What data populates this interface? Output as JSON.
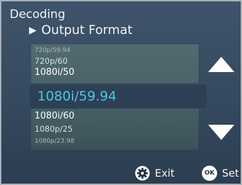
{
  "screen": {
    "title": "Decoding",
    "subtitle": "Output Format",
    "subtitle_icon": "right-triangle-icon"
  },
  "options": {
    "above": [
      "720p/59.94",
      "720p/60",
      "1080i/50"
    ],
    "selected": "1080i/59.94",
    "below": [
      "1080i/60",
      "1080p/25",
      "1080p/23.98"
    ]
  },
  "controls": {
    "scroll_up_icon": "up-arrow-icon",
    "scroll_down_icon": "down-arrow-icon",
    "exit": {
      "icon": "gear-icon",
      "label": "Exit"
    },
    "set": {
      "badge": "OK",
      "label": "Set"
    }
  },
  "colors": {
    "selected_text": "#4cc6e6",
    "background": "#3a4e64"
  }
}
